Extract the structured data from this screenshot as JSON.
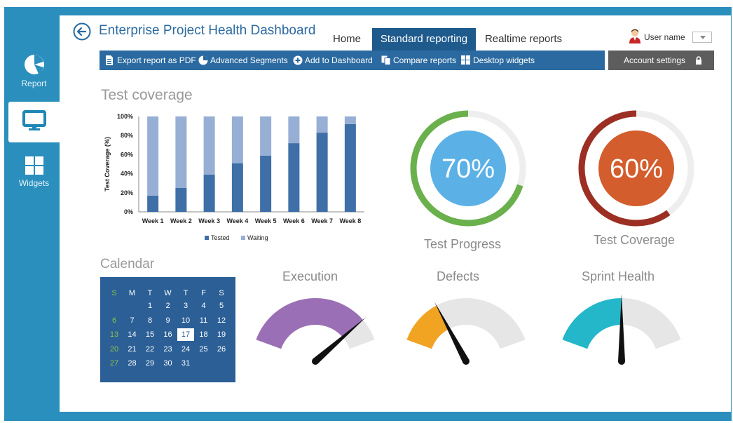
{
  "colors": {
    "frame": "#2a8fbd",
    "accent": "#2b6aa0",
    "tab_active": "#1f5a8c",
    "tested": "#3e6fa7",
    "waiting": "#97afd5",
    "progress_ring": "#6ab04c",
    "progress_fill": "#5bb1e6",
    "coverage_ring": "#9c2f23",
    "coverage_fill": "#d35d2c",
    "execution": "#9b6fb5",
    "defects": "#f1a322",
    "sprint": "#24b7c9",
    "gauge_bg": "#e6e6e6"
  },
  "sidebar": {
    "items": [
      {
        "label": "Report",
        "icon": "pie-chart-icon"
      },
      {
        "label": "",
        "icon": "monitor-icon"
      },
      {
        "label": "Widgets",
        "icon": "widgets-grid-icon"
      }
    ]
  },
  "header": {
    "title": "Enterprise Project Health Dashboard",
    "tabs": [
      {
        "label": "Home",
        "active": false
      },
      {
        "label": "Standard reporting",
        "active": true
      },
      {
        "label": "Realtime reports",
        "active": false
      }
    ],
    "user_name": "User name"
  },
  "toolbar": {
    "items": [
      {
        "label": "Export report as PDF",
        "icon": "document-icon"
      },
      {
        "label": "Advanced Segments",
        "icon": "pie-icon"
      },
      {
        "label": "Add to Dashboard",
        "icon": "plus-circle-icon"
      },
      {
        "label": "Compare reports",
        "icon": "copy-icon"
      },
      {
        "label": "Desktop widgets",
        "icon": "grid-icon"
      }
    ],
    "account": "Account settings"
  },
  "sections": {
    "coverage_title": "Test coverage",
    "calendar_title": "Calendar"
  },
  "chart_data": {
    "type": "bar",
    "stacked": true,
    "categories": [
      "Week 1",
      "Week 2",
      "Week 3",
      "Week 4",
      "Week 5",
      "Week 6",
      "Week 7",
      "Week 8"
    ],
    "series": [
      {
        "name": "Tested",
        "values": [
          17,
          25,
          39,
          51,
          59,
          72,
          83,
          92
        ]
      },
      {
        "name": "Waiting",
        "values": [
          83,
          75,
          61,
          49,
          41,
          28,
          17,
          8
        ]
      }
    ],
    "ylabel": "Test Coverage (%)",
    "xlabel": "",
    "ylim": [
      0,
      100
    ],
    "yticks": [
      "0%",
      "20%",
      "40%",
      "60%",
      "80%",
      "100%"
    ],
    "legend": "bottom",
    "grid": false
  },
  "rings": [
    {
      "label": "Test Progress",
      "value_text": "70%",
      "value": 70
    },
    {
      "label": "Test Coverage",
      "value_text": "60%",
      "value": 60
    }
  ],
  "calendar": {
    "weekdays": [
      "S",
      "M",
      "T",
      "W",
      "T",
      "F",
      "S"
    ],
    "weeks": [
      [
        "",
        "",
        "1",
        "2",
        "3",
        "4",
        "5"
      ],
      [
        "6",
        "7",
        "8",
        "9",
        "10",
        "11",
        "12"
      ],
      [
        "13",
        "14",
        "15",
        "16",
        "17",
        "18",
        "19"
      ],
      [
        "20",
        "21",
        "22",
        "23",
        "24",
        "25",
        "26"
      ],
      [
        "27",
        "28",
        "29",
        "30",
        "31",
        "",
        ""
      ]
    ],
    "today": "17"
  },
  "gauges": [
    {
      "label": "Execution",
      "value": 0.85
    },
    {
      "label": "Defects",
      "value": 0.3
    },
    {
      "label": "Sprint Health",
      "value": 0.5
    }
  ]
}
